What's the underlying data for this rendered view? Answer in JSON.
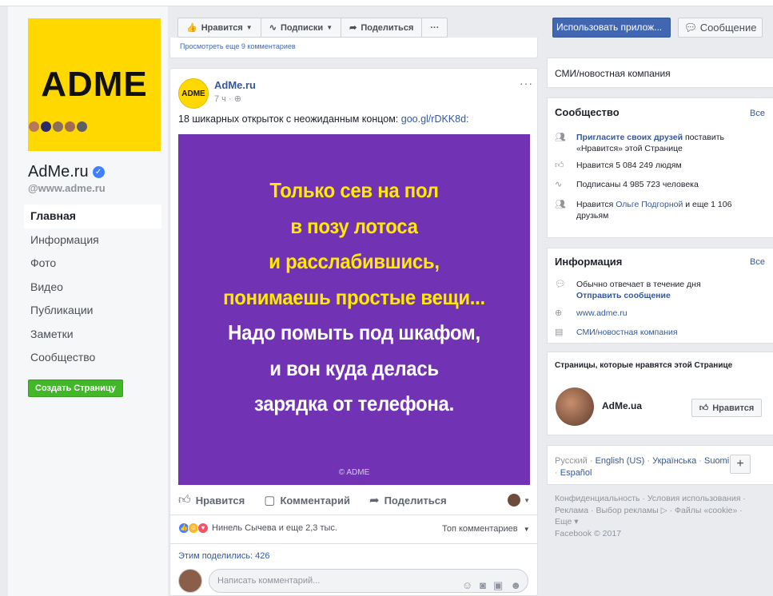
{
  "left": {
    "logo_text": "ADME",
    "page_name": "AdMe.ru",
    "page_handle": "@www.adme.ru",
    "nav": [
      "Главная",
      "Информация",
      "Фото",
      "Видео",
      "Публикации",
      "Заметки",
      "Сообщество"
    ],
    "create_page": "Создать Страницу"
  },
  "toolbar": {
    "like": "Нравится",
    "subscriptions": "Подписки",
    "share": "Поделиться",
    "more": "···"
  },
  "prev_comment_link": "Просмотреть еще 9 комментариев",
  "post": {
    "avatar_text": "ADME",
    "author": "AdMe.ru",
    "time": "7 ч ·",
    "menu": "···",
    "text": "18 шикарных открыток с неожиданным концом: ",
    "link": "goo.gl/rDKK8d:",
    "image_lines": [
      {
        "text": "Только сев на пол",
        "color": "yellow"
      },
      {
        "text": "в позу лотоса",
        "color": "yellow"
      },
      {
        "text": "и расслабившись,",
        "color": "yellow"
      },
      {
        "text": "понимаешь простые вещи...",
        "color": "yellow"
      },
      {
        "text": "Надо помыть под шкафом,",
        "color": "white"
      },
      {
        "text": "и вон куда делась",
        "color": "white"
      },
      {
        "text": "зарядка от телефона.",
        "color": "white"
      }
    ],
    "watermark": "© ADME",
    "actions": {
      "like": "Нравится",
      "comment": "Комментарий",
      "share": "Поделиться"
    },
    "reactions_text": "Нинель Сычева и еще 2,3 тыс.",
    "top_comments": "Топ комментариев",
    "shared_count": "Этим поделились: 426",
    "comment_placeholder": "Написать комментарий..."
  },
  "right": {
    "use_app": "Использовать прилож...",
    "message": "Сообщение",
    "category": "СМИ/новостная компания",
    "community": {
      "title": "Сообщество",
      "see_all": "Все",
      "invite_link": "Пригласите своих друзей",
      "invite_rest": " поставить «Нравится» этой Странице",
      "likes": "Нравится 5 084 249 людям",
      "followers": "Подписаны 4 985 723 человека",
      "friends_prefix": "Нравится ",
      "friend_name": "Ольге Подгорной",
      "friends_suffix": " и еще 1 106 друзьям"
    },
    "info": {
      "title": "Информация",
      "see_all": "Все",
      "responds": "Обычно отвечает в течение дня",
      "send_message": "Отправить сообщение",
      "website": "www.adme.ru",
      "category": "СМИ/новостная компания"
    },
    "liked_pages": {
      "title": "Страницы, которые нравятся этой Странице",
      "page_name": "AdMe.ua",
      "like_btn": "Нравится"
    },
    "languages": {
      "current": "Русский · ",
      "links": [
        "English (US)",
        "Українська",
        "Suomi",
        "Español"
      ],
      "plus": "+"
    },
    "footer": {
      "line1": "Конфиденциальность · Условия использования ·",
      "line2": "Реклама · Выбор рекламы ▷ · Файлы «cookie» ·",
      "line3": "Еще ▾",
      "line4": "Facebook © 2017"
    }
  }
}
